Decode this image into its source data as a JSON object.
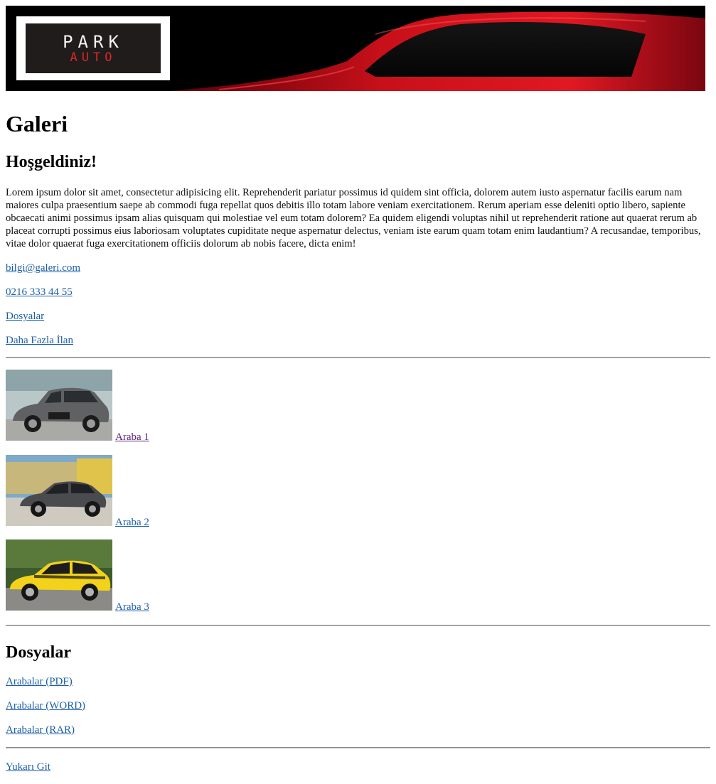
{
  "banner": {
    "logo_text_top": "PARK",
    "logo_text_bottom": "AUTO",
    "background_color": "#000000",
    "car_color": "#d6111b"
  },
  "page_title": "Galeri",
  "welcome": {
    "heading": "Hoşgeldiniz!",
    "body": "Lorem ipsum dolor sit amet, consectetur adipisicing elit. Reprehenderit pariatur possimus id quidem sint officia, dolorem autem iusto aspernatur facilis earum nam maiores culpa praesentium saepe ab commodi fuga repellat quos debitis illo totam labore veniam exercitationem. Rerum aperiam esse deleniti optio libero, sapiente obcaecati animi possimus ipsam alias quisquam qui molestiae vel eum totam dolorem? Ea quidem eligendi voluptas nihil ut reprehenderit ratione aut quaerat rerum ab placeat corrupti possimus eius laboriosam voluptates cupiditate neque aspernatur delectus, veniam iste earum quam totam enim laudantium? A recusandae, temporibus, vitae dolor quaerat fuga exercitationem officiis dolorum ab nobis facere, dicta enim!"
  },
  "contact_links": {
    "email": "bilgi@galeri.com",
    "phone": "0216 333 44 55",
    "files": "Dosyalar",
    "more_listings": "Daha Fazla İlan"
  },
  "cars": [
    {
      "label": "Araba 1",
      "visited": true,
      "body_color": "#5f6163"
    },
    {
      "label": "Araba 2",
      "visited": false,
      "body_color": "#4a4b4e"
    },
    {
      "label": "Araba 3",
      "visited": false,
      "body_color": "#f2d21b"
    }
  ],
  "files_section": {
    "heading": "Dosyalar",
    "links": [
      "Arabalar (PDF)",
      "Arabalar (WORD)",
      "Arabalar (RAR)"
    ]
  },
  "footer": {
    "back_to_top": "Yukarı Git"
  },
  "colors": {
    "link": "#1a5ea8",
    "visited_link": "#5a1f7a"
  }
}
